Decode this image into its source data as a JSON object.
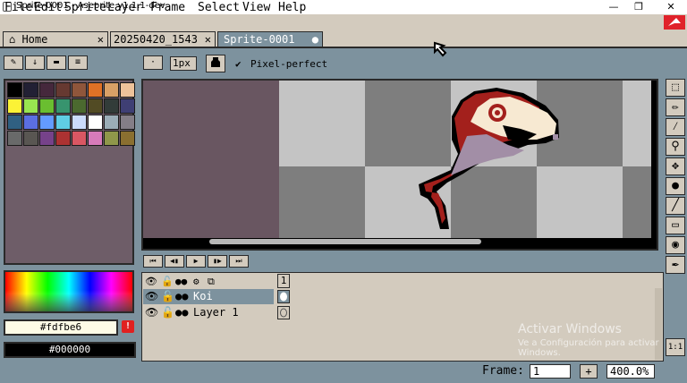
{
  "window": {
    "title": "Sprite-0001 - Aseprite v1.1.1-dev",
    "minimize": "—",
    "maximize": "❐",
    "close": "✕"
  },
  "menu": [
    "File",
    "Edit",
    "Sprite",
    "Layer",
    "Frame",
    "Select",
    "View",
    "Help"
  ],
  "tabs": [
    {
      "label": "⌂ Home",
      "close": "✕"
    },
    {
      "label": "20250420_1543",
      "close": "✕"
    },
    {
      "label": "Sprite-0001",
      "close": "●"
    }
  ],
  "toolbar": {
    "brush_size": "1px",
    "pixel_perfect_label": "Pixel-perfect",
    "pixel_perfect_checked": "✔"
  },
  "palette": {
    "colors": [
      "#000000",
      "#222034",
      "#45283c",
      "#663931",
      "#8f563b",
      "#df7126",
      "#d9a066",
      "#eec39a",
      "#fbf236",
      "#99e550",
      "#6abe30",
      "#37946e",
      "#4b692f",
      "#524b24",
      "#323c39",
      "#3f3f74",
      "#306082",
      "#5b6ee1",
      "#639bff",
      "#5fcde4",
      "#cbdbfc",
      "#ffffff",
      "#9badb7",
      "#847e87",
      "#696a6a",
      "#595652",
      "#76428a",
      "#ac3232",
      "#d95763",
      "#d77bba",
      "#8f974a",
      "#8a6f30"
    ]
  },
  "colors": {
    "foreground_hex": "#fdfbe6",
    "background_hex": "#000000",
    "warning": "!"
  },
  "timeline": {
    "frame_number": "1",
    "layers": [
      {
        "name": "Koi"
      },
      {
        "name": "Layer 1"
      }
    ]
  },
  "watermark": {
    "line1": "Activar Windows",
    "line2": "Ve a Configuración para activar",
    "line3": "Windows."
  },
  "status": {
    "frame_label": "Frame:",
    "frame_value": "1",
    "add": "+",
    "zoom": "400.0%"
  }
}
